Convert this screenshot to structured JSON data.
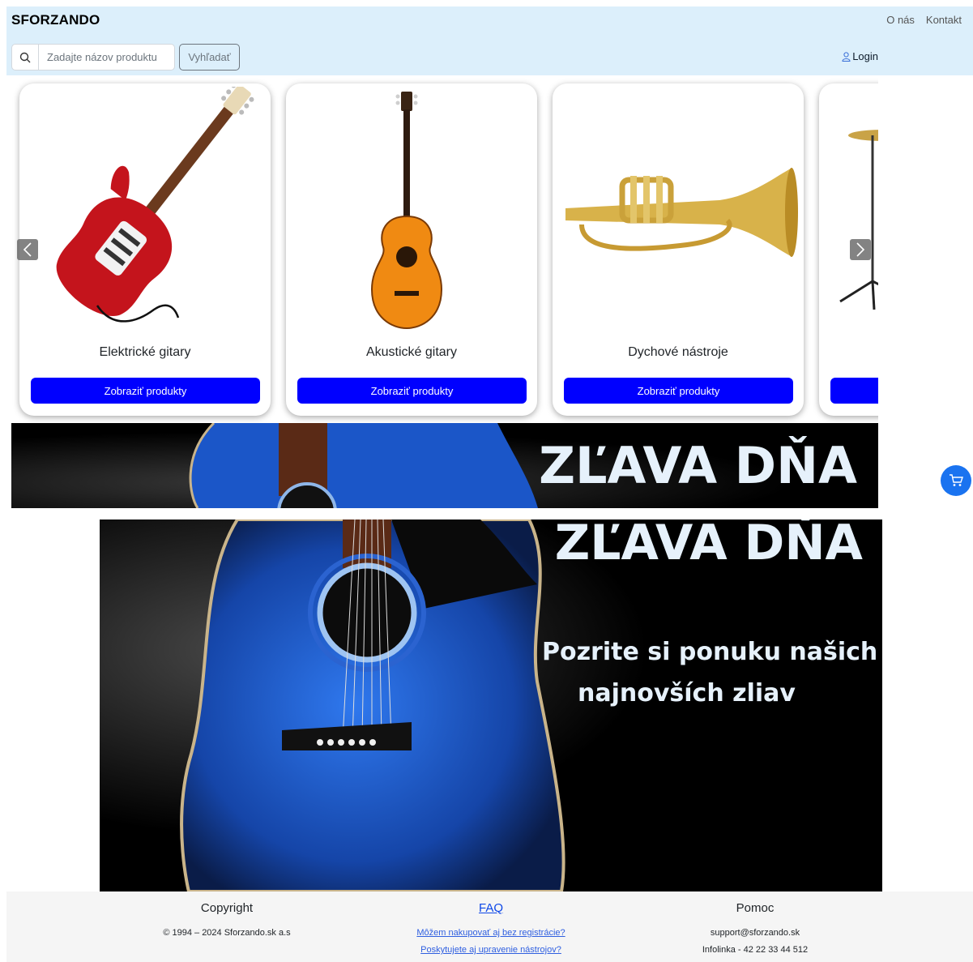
{
  "header": {
    "brand": "SFORZANDO",
    "nav": [
      "O nás",
      "Kontakt"
    ],
    "search_placeholder": "Zadajte názov produktu",
    "search_button": "Vyhľadať",
    "login": "Login"
  },
  "carousel": {
    "cards": [
      {
        "title": "Elektrické gitary",
        "button": "Zobraziť produkty",
        "icon": "electric-guitar"
      },
      {
        "title": "Akustické gitary",
        "button": "Zobraziť produkty",
        "icon": "acoustic-guitar"
      },
      {
        "title": "Dychové nástroje",
        "button": "Zobraziť produkty",
        "icon": "trumpet"
      },
      {
        "title": "",
        "button": "",
        "icon": "drum-cymbal"
      }
    ]
  },
  "banners": {
    "strip_text": "ZĽAVA DŇA",
    "big_text": "ZĽAVA DŇA",
    "big_line1": "Pozrite si ponuku našich",
    "big_line2": "najnovších zliav"
  },
  "footer": {
    "copyright_title": "Copyright",
    "copyright_text": "© 1994 – 2024 Sforzando.sk a.s",
    "faq_title": "FAQ",
    "faq_links": [
      "Môžem nakupovať aj bez registrácie?",
      "Poskytujete aj upravenie nástrojov?"
    ],
    "help_title": "Pomoc",
    "help_email": "support@sforzando.sk",
    "help_phone": "Infolinka - 42 22 33 44 512"
  },
  "colors": {
    "header_bg": "#dceffb",
    "primary_button": "#0000ff",
    "cart_button": "#1a73f0",
    "guitar_blue": "#1b56c8"
  }
}
